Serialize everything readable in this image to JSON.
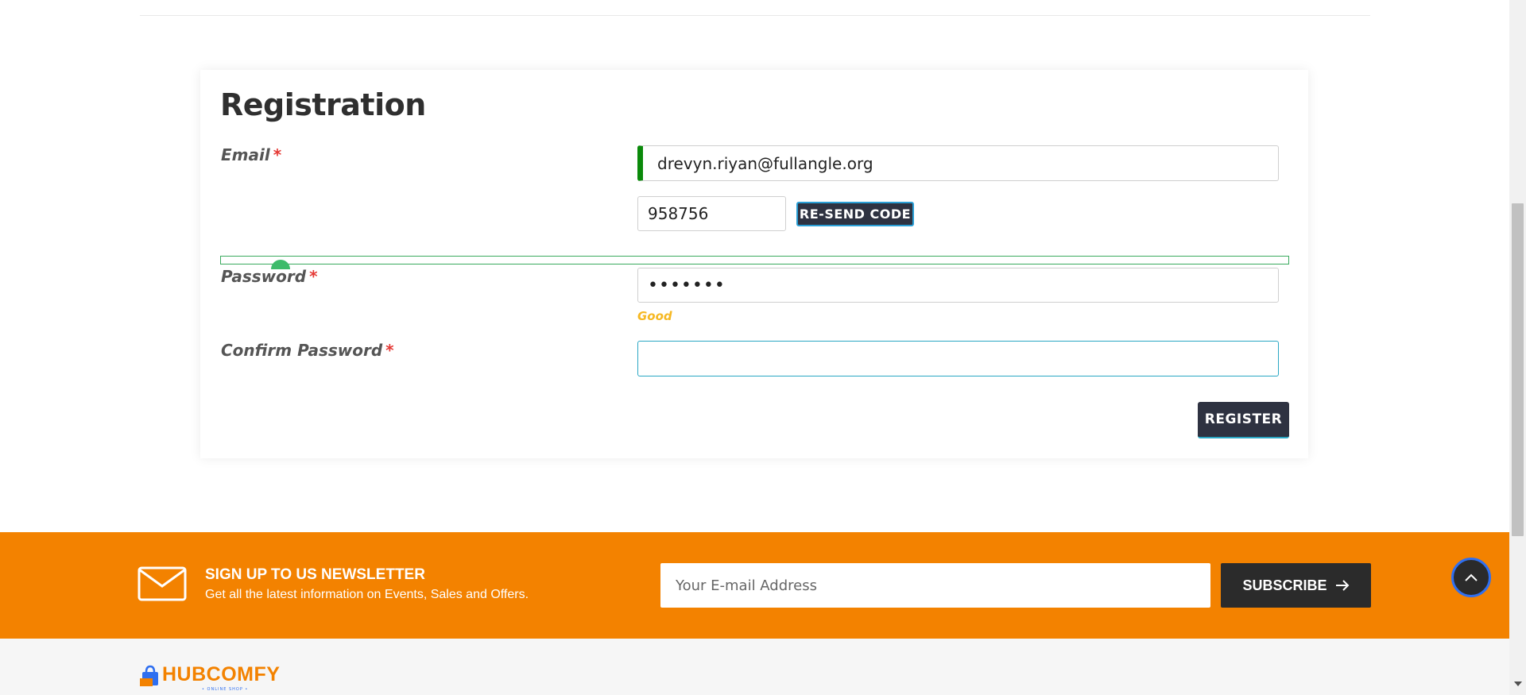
{
  "registration": {
    "title": "Registration",
    "email_label": "Email",
    "email_value": "drevyn.riyan@fullangle.org",
    "code_value": "958756",
    "resend_label": "RE-SEND CODE",
    "password_label": "Password",
    "password_value": "•••••••",
    "strength_text": "Good",
    "confirm_label": "Confirm Password",
    "confirm_value": "",
    "required_mark": "*",
    "register_label": "REGISTER"
  },
  "newsletter": {
    "title": "SIGN UP TO US NEWSLETTER",
    "subtitle": "Get all the latest information on Events, Sales and Offers.",
    "input_placeholder": "Your E-mail Address",
    "subscribe_label": "SUBSCRIBE",
    "background_color": "#f38200"
  },
  "footer": {
    "logo_text": "HUBCOMFY",
    "logo_subtext": "• ONLINE SHOP •"
  },
  "colors": {
    "accent_dark": "#2e3241",
    "email_valid_bar": "#0a8a0a",
    "strength_good": "#f6b822",
    "focus_border": "#2aa7c4"
  },
  "icons": [
    "mail-icon",
    "arrow-right-icon",
    "chevron-up-icon",
    "shopping-bag-icon"
  ]
}
